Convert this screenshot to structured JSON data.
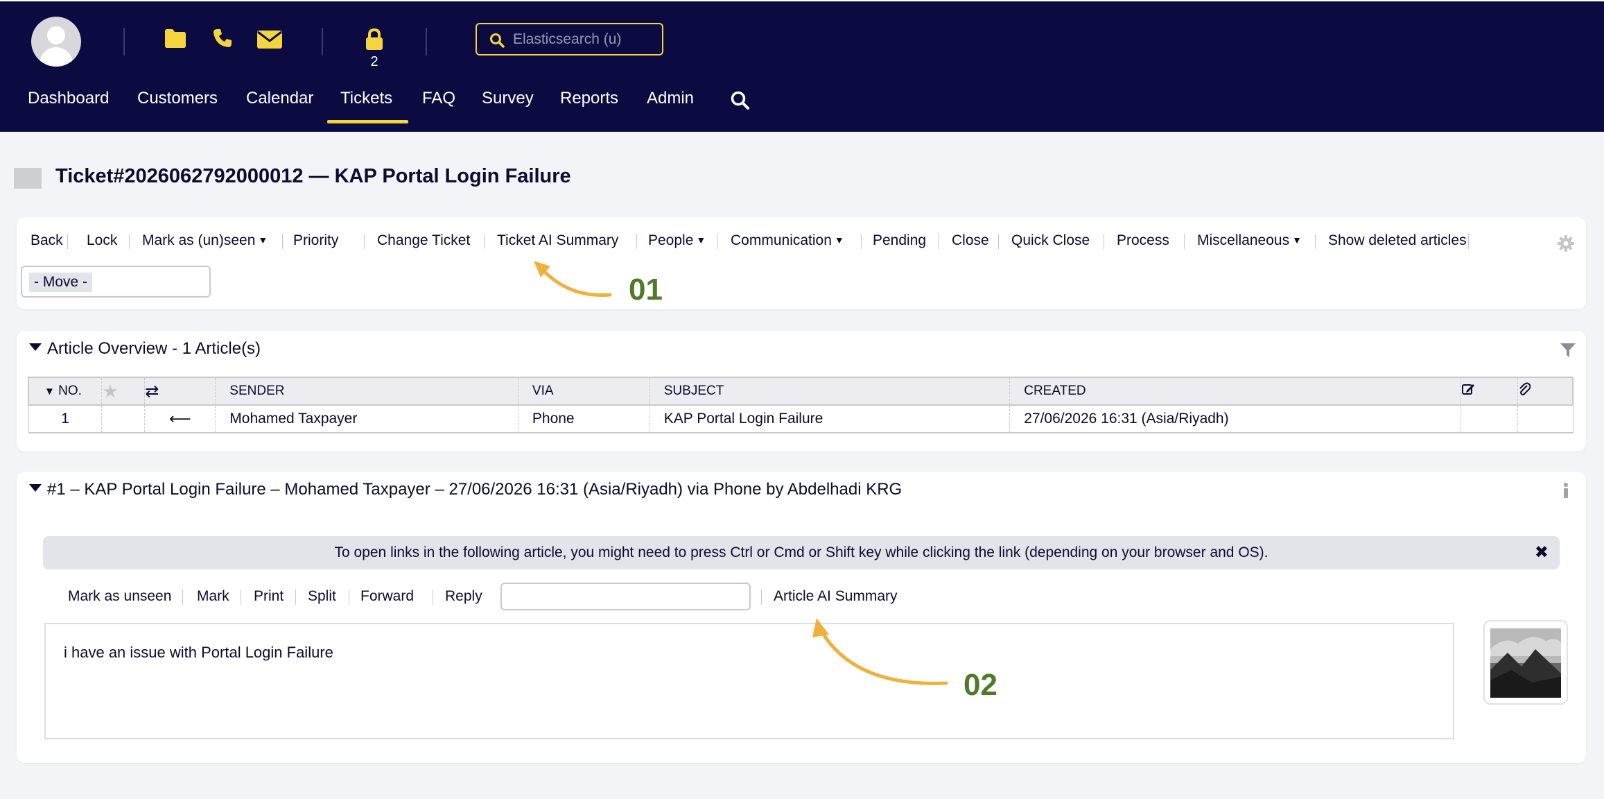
{
  "header": {
    "lock_count": "2",
    "search_placeholder": "Elasticsearch (u)",
    "nav": [
      "Dashboard",
      "Customers",
      "Calendar",
      "Tickets",
      "FAQ",
      "Survey",
      "Reports",
      "Admin"
    ],
    "active_nav": "Tickets",
    "colors": {
      "background": "#0b0b42",
      "accent": "#f5d53d"
    }
  },
  "ticket": {
    "title": "Ticket#2026062792000012 — KAP Portal Login Failure"
  },
  "ticket_actions": {
    "items": [
      "Back",
      "Lock",
      "Mark as (un)seen",
      "Priority",
      "Change Ticket",
      "Ticket AI Summary",
      "People",
      "Communication",
      "Pending",
      "Close",
      "Quick Close",
      "Process",
      "Miscellaneous",
      "Show deleted articles"
    ],
    "dropdown_items": [
      "Mark as (un)seen",
      "People",
      "Communication",
      "Miscellaneous"
    ],
    "move_value": "- Move -"
  },
  "article_overview": {
    "title": "Article Overview - 1 Article(s)",
    "columns": [
      "NO.",
      "",
      "",
      "SENDER",
      "VIA",
      "SUBJECT",
      "CREATED",
      "",
      ""
    ],
    "rows": [
      {
        "no": "1",
        "sender": "Mohamed Taxpayer",
        "via": "Phone",
        "subject": "KAP Portal Login Failure",
        "created": "27/06/2026 16:31 (Asia/Riyadh)"
      }
    ]
  },
  "article": {
    "title": "#1 – KAP Portal Login Failure – Mohamed Taxpayer – 27/06/2026 16:31 (Asia/Riyadh) via Phone by Abdelhadi KRG",
    "notice": "To open links in the following article, you might need to press Ctrl or Cmd or Shift key while clicking the link (depending on your browser and OS).",
    "actions": [
      "Mark as unseen",
      "Mark",
      "Print",
      "Split",
      "Forward",
      "Reply"
    ],
    "ai_summary": "Article AI Summary",
    "body": "i have an issue with Portal Login Failure"
  },
  "callouts": [
    "01",
    "02"
  ],
  "callout_color": "#4f7a2a",
  "arrow_color": "#f0b03c"
}
